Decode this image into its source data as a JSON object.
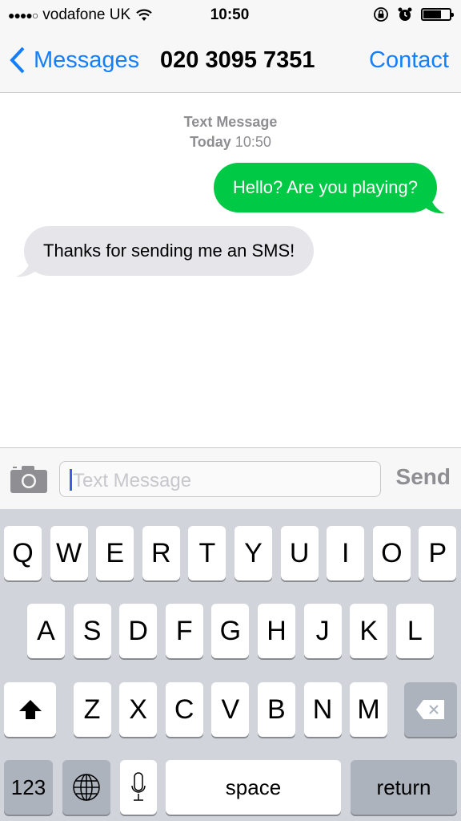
{
  "status_bar": {
    "signal": "●●●●○",
    "carrier": "vodafone UK",
    "time": "10:50",
    "icons": [
      "wifi-icon",
      "rotation-lock-icon",
      "alarm-icon",
      "battery-icon"
    ],
    "battery_level": 0.6
  },
  "nav": {
    "back_label": "Messages",
    "title": "020 3095 7351",
    "contact_label": "Contact"
  },
  "conversation": {
    "meta_type": "Text Message",
    "meta_day": "Today",
    "meta_time": "10:50",
    "messages": [
      {
        "direction": "outgoing",
        "text": "Hello? Are you playing?"
      },
      {
        "direction": "incoming",
        "text": "Thanks for sending me an SMS!"
      }
    ]
  },
  "composer": {
    "placeholder": "Text Message",
    "value": "",
    "send_label": "Send"
  },
  "keyboard": {
    "row1": [
      "Q",
      "W",
      "E",
      "R",
      "T",
      "Y",
      "U",
      "I",
      "O",
      "P"
    ],
    "row2": [
      "A",
      "S",
      "D",
      "F",
      "G",
      "H",
      "J",
      "K",
      "L"
    ],
    "row3": [
      "Z",
      "X",
      "C",
      "V",
      "B",
      "N",
      "M"
    ],
    "numbers_label": "123",
    "space_label": "space",
    "return_label": "return"
  },
  "colors": {
    "accent": "#147efb",
    "outgoing_bubble": "#00c946",
    "incoming_bubble": "#e5e5ea"
  }
}
